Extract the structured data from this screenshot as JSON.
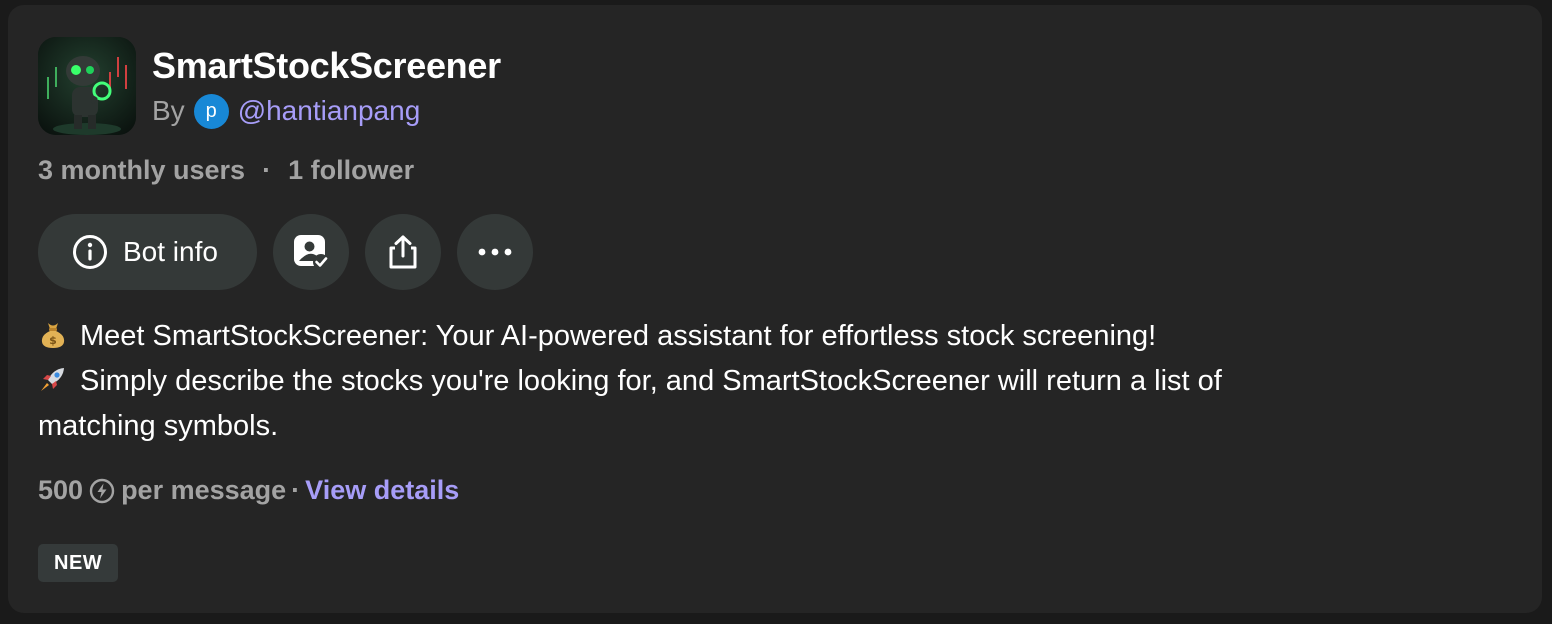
{
  "bot": {
    "name": "SmartStockScreener",
    "by_label": "By",
    "creator_initial": "p",
    "creator_handle": "@hantianpang",
    "monthly_users": "3 monthly users",
    "separator": "·",
    "followers": "1 follower"
  },
  "actions": {
    "bot_info_label": "Bot info",
    "icons": [
      "info-icon",
      "profile-check-icon",
      "share-icon",
      "more-icon"
    ]
  },
  "description": {
    "line1_emoji": "money-bag-emoji",
    "line1": "Meet SmartStockScreener: Your AI-powered assistant for effortless stock screening!",
    "line2_emoji": "rocket-emoji",
    "line2": "Simply describe the stocks you're looking for, and SmartStockScreener will return a list of",
    "line3": "matching symbols."
  },
  "pricing": {
    "points": "500",
    "per_message": "per message",
    "separator": "·",
    "view_details": "View details"
  },
  "badge": "NEW",
  "colors": {
    "background": "#1a1a1a",
    "card": "#252525",
    "pill": "#343938",
    "accent_link": "#a79df8",
    "muted_text": "#a3a3a3",
    "creator_avatar": "#1888d6"
  }
}
